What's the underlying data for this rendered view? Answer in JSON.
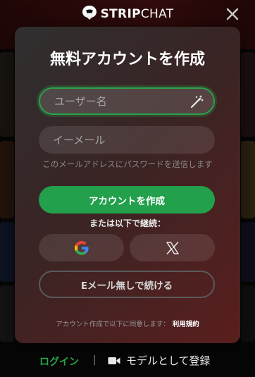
{
  "brand": {
    "bold": "STRIP",
    "light": "CHAT"
  },
  "modal": {
    "title": "無料アカウントを作成",
    "username_placeholder": "ユーザー名",
    "email_placeholder": "イーメール",
    "email_hint": "このメールアドレスにパスワードを送信します",
    "create_button": "アカウントを作成",
    "or_continue": "または以下で継続：",
    "no_email_button": "Eメール無しで続ける",
    "terms_text": "アカウント作成で以下に同意します：",
    "terms_link": "利用規約"
  },
  "bottom": {
    "login": "ログイン",
    "separator": "|",
    "model_signup": "モデルとして登録"
  },
  "icons": {
    "close": "close-icon",
    "wand": "magic-wand-icon",
    "google": "google-icon",
    "x": "x-logo-icon",
    "camera": "video-camera-icon"
  },
  "colors": {
    "accent_green": "#22a04b",
    "header_red": "#5a1515"
  }
}
